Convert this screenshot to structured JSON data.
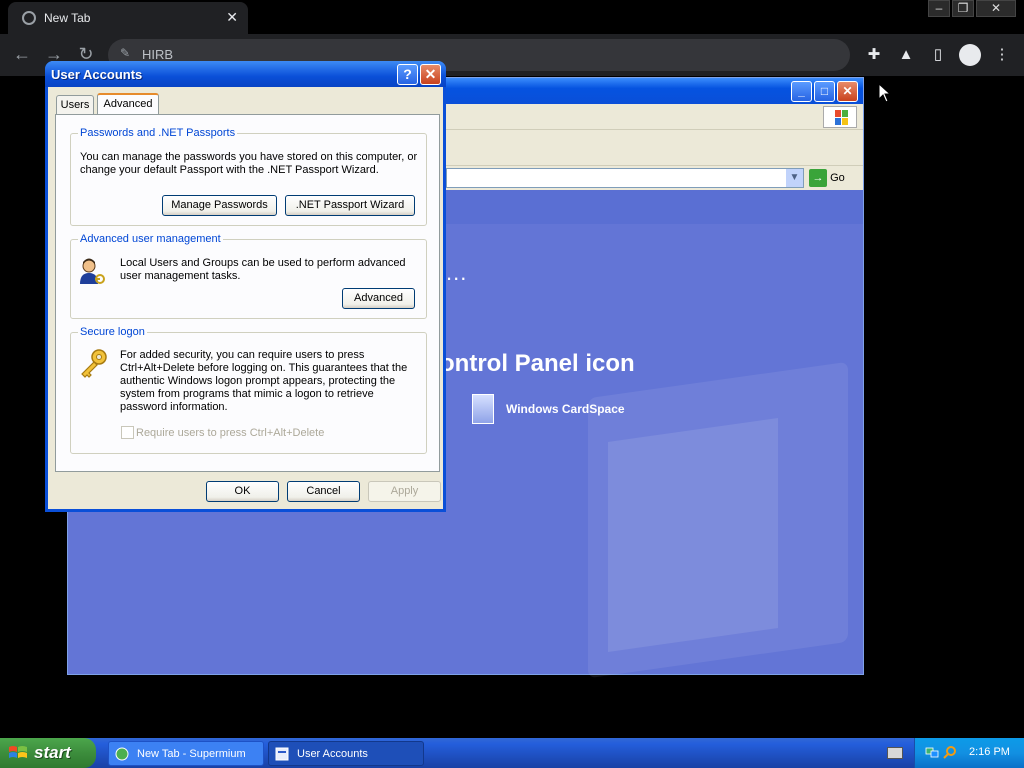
{
  "browser": {
    "tab_title": "New Tab",
    "url": "HIRB",
    "tab_close": "✕"
  },
  "bg_window": {
    "pick_heading": "ontrol Panel icon",
    "dots": "...",
    "cardspace_label": "Windows CardSpace",
    "go_label": "Go"
  },
  "dialog": {
    "title": "User Accounts",
    "help_glyph": "?",
    "close_glyph": "✕",
    "tabs": [
      "Users",
      "Advanced"
    ],
    "passwords_group": {
      "label": "Passwords and .NET Passports",
      "text": "You can manage the passwords you have stored on this computer, or change your default Passport with the .NET Passport Wizard.",
      "manage_button": "Manage Passwords",
      "wizard_button": ".NET Passport Wizard"
    },
    "advanced_group": {
      "label": "Advanced user management",
      "text": "Local Users and Groups can be used to perform advanced user management tasks.",
      "advanced_button": "Advanced"
    },
    "secure_group": {
      "label": "Secure logon",
      "text": "For added security, you can require users to press Ctrl+Alt+Delete before logging on. This guarantees that the authentic Windows logon prompt appears, protecting the system from programs that mimic a logon to retrieve password information.",
      "checkbox_label": "Require users to press Ctrl+Alt+Delete"
    },
    "ok_button": "OK",
    "cancel_button": "Cancel",
    "apply_button": "Apply"
  },
  "taskbar": {
    "start_label": "start",
    "tasks": [
      "New Tab - Supermium",
      "User Accounts"
    ],
    "clock": "2:16 PM"
  }
}
